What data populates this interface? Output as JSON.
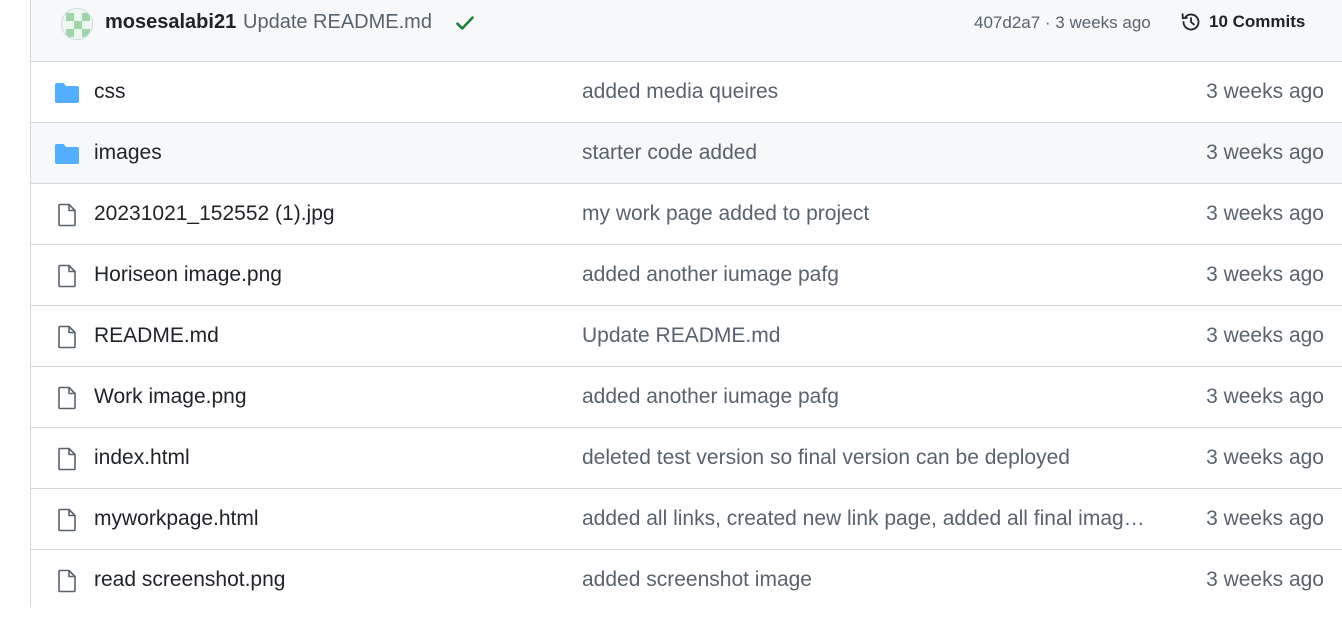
{
  "latest_commit": {
    "author": "mosesalabi21",
    "message": "Update README.md",
    "status_icon": "check-icon",
    "meta": "407d2a7 · 3 weeks ago",
    "commits_label": "10 Commits"
  },
  "colors": {
    "folder": "#54aeff",
    "success": "#1a7f37",
    "muted": "#59636e",
    "border": "#d0d7de"
  },
  "files": [
    {
      "type": "folder",
      "name": "css",
      "message": "added media queires",
      "date": "3 weeks ago"
    },
    {
      "type": "folder",
      "name": "images",
      "message": "starter code added",
      "date": "3 weeks ago"
    },
    {
      "type": "file",
      "name": "20231021_152552 (1).jpg",
      "message": "my work page added to project",
      "date": "3 weeks ago"
    },
    {
      "type": "file",
      "name": "Horiseon image.png",
      "message": "added another iumage pafg",
      "date": "3 weeks ago"
    },
    {
      "type": "file",
      "name": "README.md",
      "message": "Update README.md",
      "date": "3 weeks ago"
    },
    {
      "type": "file",
      "name": "Work image.png",
      "message": "added another iumage pafg",
      "date": "3 weeks ago"
    },
    {
      "type": "file",
      "name": "index.html",
      "message": "deleted test version so final version can be deployed",
      "date": "3 weeks ago"
    },
    {
      "type": "file",
      "name": "myworkpage.html",
      "message": "added all links, created new link page, added all final imag…",
      "date": "3 weeks ago"
    },
    {
      "type": "file",
      "name": "read screenshot.png",
      "message": "added screenshot image",
      "date": "3 weeks ago"
    }
  ]
}
